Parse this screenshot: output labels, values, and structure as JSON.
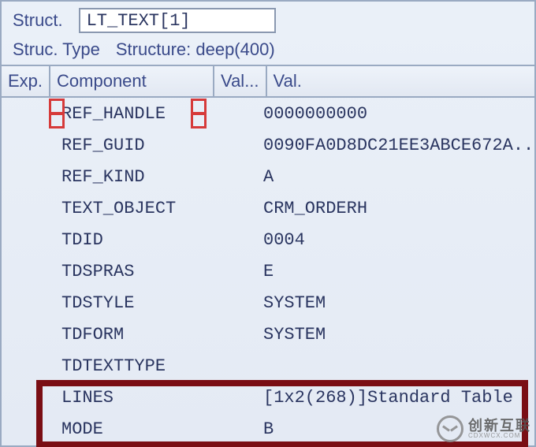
{
  "header": {
    "struct_label": "Struct.",
    "struct_value": "LT_TEXT[1]",
    "type_label": "Struc. Type",
    "type_value": "Structure: deep(400)"
  },
  "columns": {
    "exp": "Exp.",
    "component": "Component",
    "val_type": "Val...",
    "val": "Val."
  },
  "rows": [
    {
      "component": "REF_HANDLE",
      "value": "0000000000"
    },
    {
      "component": "REF_GUID",
      "value": "0090FA0D8DC21EE3ABCE672A..."
    },
    {
      "component": "REF_KIND",
      "value": "A"
    },
    {
      "component": "TEXT_OBJECT",
      "value": "CRM_ORDERH"
    },
    {
      "component": "TDID",
      "value": "0004"
    },
    {
      "component": "TDSPRAS",
      "value": "E"
    },
    {
      "component": "TDSTYLE",
      "value": "SYSTEM"
    },
    {
      "component": "TDFORM",
      "value": "SYSTEM"
    },
    {
      "component": "TDTEXTTYPE",
      "value": ""
    },
    {
      "component": "LINES",
      "value": "[1x2(268)]Standard Table"
    },
    {
      "component": "MODE",
      "value": "B"
    }
  ],
  "watermark": {
    "main": "创新互联",
    "sub": "CDXWCX.COM"
  }
}
